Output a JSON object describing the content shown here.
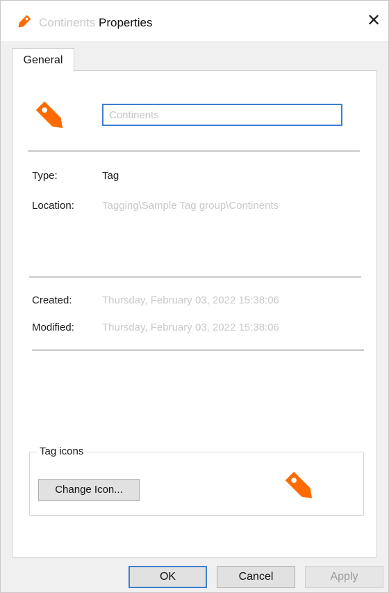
{
  "window": {
    "title_name": "Continents",
    "title_suffix": "Properties",
    "close_glyph": "✕"
  },
  "tabs": [
    {
      "label": "General",
      "selected": true
    }
  ],
  "general": {
    "name_value": "Continents",
    "type_label": "Type:",
    "type_value": "Tag",
    "location_label": "Location:",
    "location_value": "Tagging\\Sample Tag group\\Continents",
    "created_label": "Created:",
    "created_value": "Thursday, February 03, 2022 15:38:06",
    "modified_label": "Modified:",
    "modified_value": "Thursday, February 03, 2022 15:38:06"
  },
  "tag_icons": {
    "legend": "Tag icons",
    "change_button": "Change Icon..."
  },
  "buttons": {
    "ok": "OK",
    "cancel": "Cancel",
    "apply": "Apply"
  },
  "icons": {
    "tag_icon": "tag-icon",
    "close_icon": "close-icon"
  },
  "colors": {
    "tag_orange": "#ff6a00",
    "focus_blue": "#3c7fd1"
  }
}
